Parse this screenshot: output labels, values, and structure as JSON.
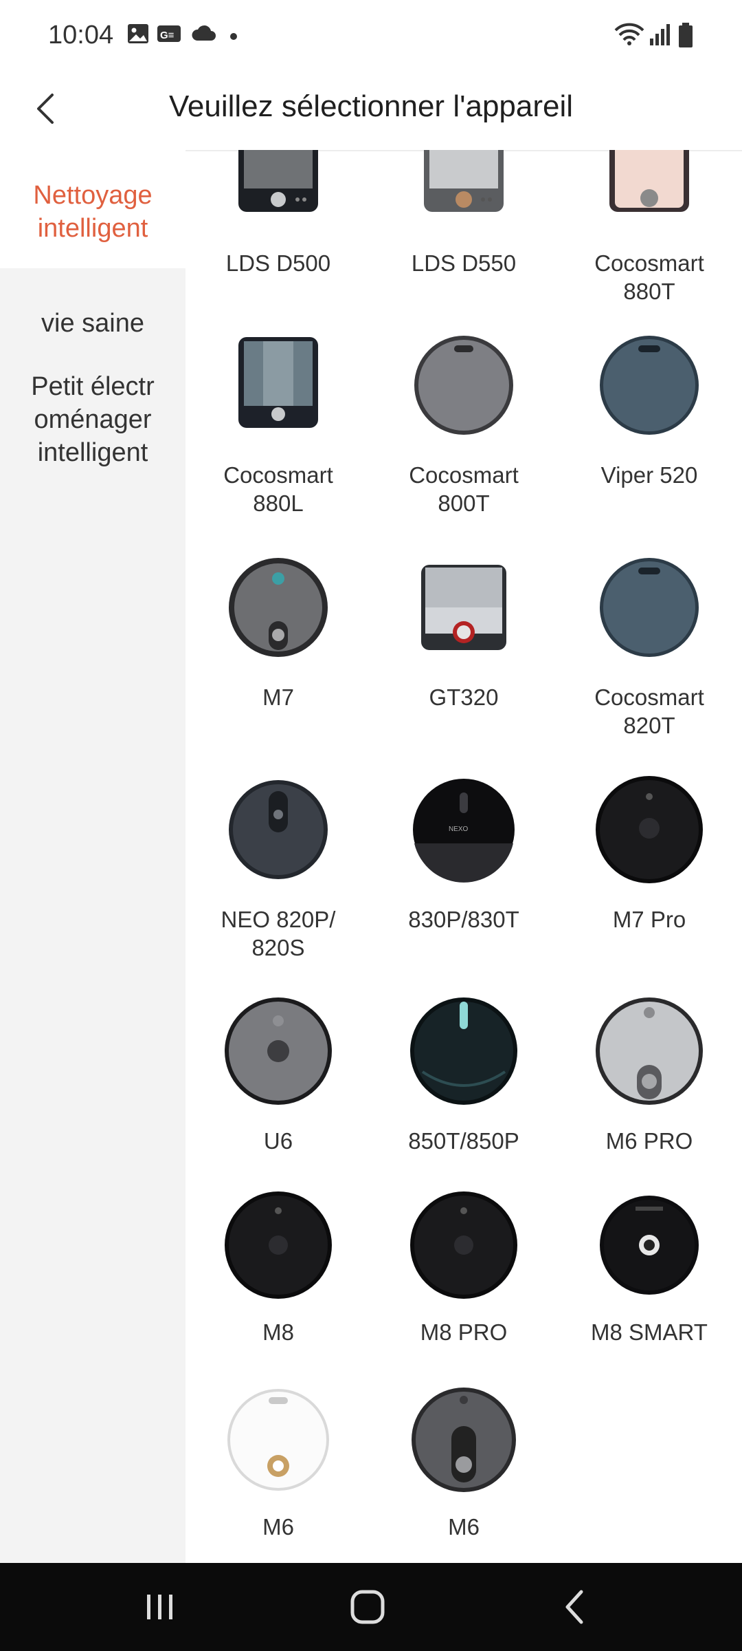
{
  "status_bar": {
    "time": "10:04",
    "left_icons": [
      "image-icon",
      "news-icon",
      "cloud-icon",
      "dot-icon"
    ],
    "right_icons": [
      "wifi-icon",
      "signal-icon",
      "battery-icon"
    ]
  },
  "header": {
    "title": "Veuillez sélectionner l'appareil",
    "back_icon": "chevron-left-icon"
  },
  "sidebar": {
    "categories": [
      {
        "label": "Nettoyage\nintelligent",
        "active": true
      },
      {
        "label": "vie saine",
        "active": false
      },
      {
        "label": "Petit électr\noménager\nintelligent",
        "active": false
      }
    ]
  },
  "devices": [
    {
      "name": "LDS D500"
    },
    {
      "name": "LDS D550"
    },
    {
      "name": "Cocosmart\n880T"
    },
    {
      "name": "Cocosmart\n880L"
    },
    {
      "name": "Cocosmart\n800T"
    },
    {
      "name": "Viper 520"
    },
    {
      "name": "M7"
    },
    {
      "name": "GT320"
    },
    {
      "name": "Cocosmart\n820T"
    },
    {
      "name": "NEO 820P/\n820S"
    },
    {
      "name": "830P/830T"
    },
    {
      "name": "M7 Pro"
    },
    {
      "name": "U6"
    },
    {
      "name": "850T/850P"
    },
    {
      "name": "M6 PRO"
    },
    {
      "name": "M8"
    },
    {
      "name": "M8 PRO"
    },
    {
      "name": "M8 SMART"
    },
    {
      "name": "M6"
    },
    {
      "name": "M6"
    }
  ],
  "nav_bar": {
    "icons": [
      "recent-apps-icon",
      "home-icon",
      "back-icon"
    ]
  },
  "colors": {
    "accent": "#e0603f",
    "sidebar_bg": "#f3f3f3",
    "navbar_bg": "#0b0b0b"
  }
}
